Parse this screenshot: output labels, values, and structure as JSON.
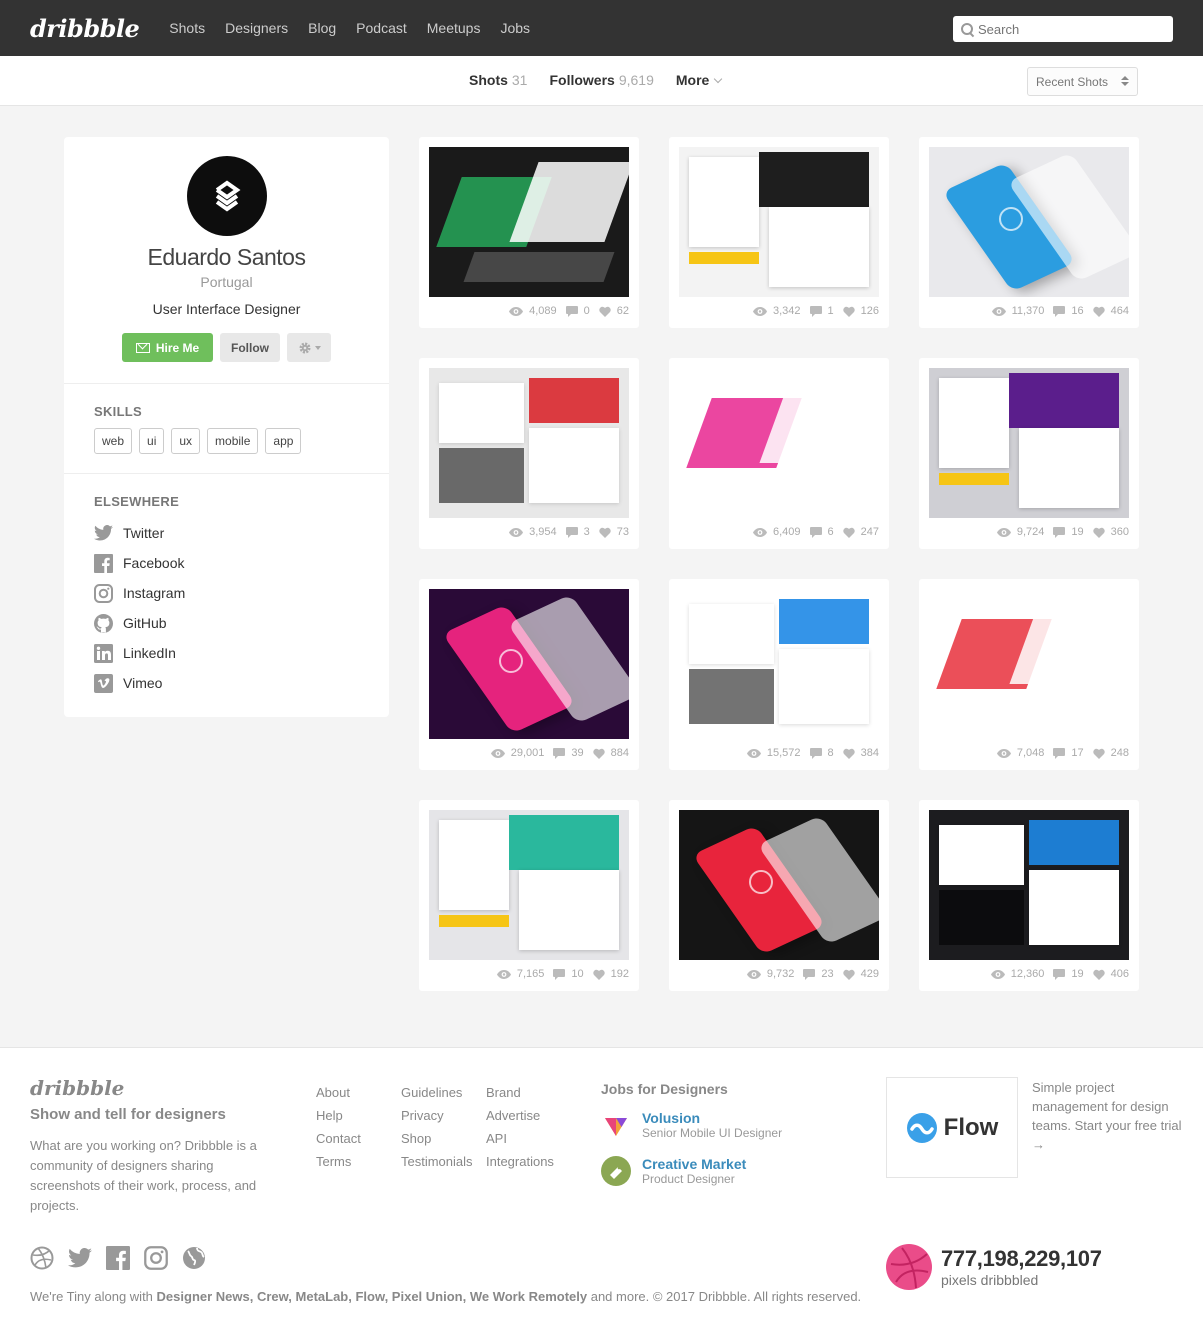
{
  "header": {
    "logo": "dribbble",
    "nav": [
      "Shots",
      "Designers",
      "Blog",
      "Podcast",
      "Meetups",
      "Jobs"
    ],
    "search_placeholder": "Search"
  },
  "subnav": {
    "tabs": [
      {
        "label": "Shots",
        "count": "31"
      },
      {
        "label": "Followers",
        "count": "9,619"
      },
      {
        "label": "More",
        "count": ""
      }
    ],
    "sort": "Recent Shots"
  },
  "profile": {
    "name": "Eduardo Santos",
    "location": "Portugal",
    "bio": "User Interface Designer",
    "hire_label": "Hire Me",
    "follow_label": "Follow",
    "skills_title": "SKILLS",
    "skills": [
      "web",
      "ui",
      "ux",
      "mobile",
      "app"
    ],
    "elsewhere_title": "ELSEWHERE",
    "elsewhere": [
      {
        "label": "Twitter",
        "icon": "twitter-icon"
      },
      {
        "label": "Facebook",
        "icon": "facebook-icon"
      },
      {
        "label": "Instagram",
        "icon": "instagram-icon"
      },
      {
        "label": "GitHub",
        "icon": "github-icon"
      },
      {
        "label": "LinkedIn",
        "icon": "linkedin-icon"
      },
      {
        "label": "Vimeo",
        "icon": "vimeo-icon"
      }
    ]
  },
  "shots": [
    {
      "views": "4,089",
      "comments": "0",
      "likes": "62",
      "bg": "#1a1a1a",
      "accent": "#27a85b"
    },
    {
      "views": "3,342",
      "comments": "1",
      "likes": "126",
      "bg": "#f3f3f3",
      "accent": "#1e1e1e"
    },
    {
      "views": "11,370",
      "comments": "16",
      "likes": "464",
      "bg": "#e9e9ec",
      "accent": "#2b9de0"
    },
    {
      "views": "3,954",
      "comments": "3",
      "likes": "73",
      "bg": "#e8e8e8",
      "accent": "#d9272e"
    },
    {
      "views": "6,409",
      "comments": "6",
      "likes": "247",
      "bg": "#ffffff",
      "accent": "#e8268f"
    },
    {
      "views": "9,724",
      "comments": "19",
      "likes": "360",
      "bg": "#cfcfd4",
      "accent": "#5b1e8c"
    },
    {
      "views": "29,001",
      "comments": "39",
      "likes": "884",
      "bg": "#2a0a37",
      "accent": "#e5237d"
    },
    {
      "views": "15,572",
      "comments": "8",
      "likes": "384",
      "bg": "#ffffff",
      "accent": "#1e88e5"
    },
    {
      "views": "7,048",
      "comments": "17",
      "likes": "248",
      "bg": "#ffffff",
      "accent": "#e8303c"
    },
    {
      "views": "7,165",
      "comments": "10",
      "likes": "192",
      "bg": "#e5e5e8",
      "accent": "#2ab89d"
    },
    {
      "views": "9,732",
      "comments": "23",
      "likes": "429",
      "bg": "#151515",
      "accent": "#e8243c"
    },
    {
      "views": "12,360",
      "comments": "19",
      "likes": "406",
      "bg": "#1c1c1f",
      "accent": "#1e88e5"
    }
  ],
  "footer": {
    "logo": "dribbble",
    "tagline": "Show and tell for designers",
    "description": "What are you working on? Dribbble is a community of designers sharing screenshots of their work, process, and projects.",
    "col1": [
      "About",
      "Help",
      "Contact",
      "Terms"
    ],
    "col2": [
      "Guidelines",
      "Privacy",
      "Shop",
      "Testimonials"
    ],
    "col3": [
      "Brand",
      "Advertise",
      "API",
      "Integrations"
    ],
    "jobs_title": "Jobs for Designers",
    "jobs": [
      {
        "company": "Volusion",
        "role": "Senior Mobile UI Designer"
      },
      {
        "company": "Creative Market",
        "role": "Product Designer"
      }
    ],
    "ad_name": "Flow",
    "ad_text": "Simple project management for design teams. Start your free trial →",
    "legal_prefix": "We're Tiny along with",
    "legal_brands": "Designer News, Crew, MetaLab, Flow, Pixel Union, We Work Remotely",
    "legal_suffix": "and more. © 2017 Dribbble. All rights reserved.",
    "counter": "777,198,229,107",
    "counter_label": "pixels dribbbled"
  }
}
